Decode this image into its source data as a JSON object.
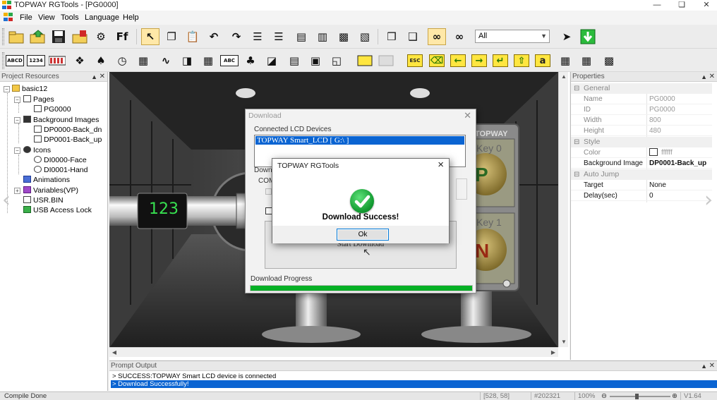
{
  "window": {
    "title": "TOPWAY RGTools - [PG0000]"
  },
  "menu": {
    "items": [
      "File",
      "View",
      "Tools",
      "Language",
      "Help"
    ]
  },
  "toolbar": {
    "filter_value": "All",
    "row1_icons": [
      "new-project-icon",
      "open-project-icon",
      "save-icon",
      "export-icon",
      "settings-icon",
      "font-icon",
      "select-pointer-icon",
      "copy-icon",
      "paste-icon",
      "undo-icon",
      "redo-icon",
      "align-left-icon",
      "align-right-icon",
      "align-top-icon",
      "align-bottom-icon",
      "distribute-horizontal-icon",
      "distribute-vertical-icon",
      "bring-front-icon",
      "send-back-icon",
      "preview-glasses-icon",
      "preview-off-icon",
      "build-icon",
      "download-icon"
    ],
    "row2_labels": {
      "abcd": "ABCD",
      "n1234": "1234",
      "abc": "ABC"
    }
  },
  "project_panel": {
    "title": "Project Resources",
    "tree": [
      {
        "label": "basic12",
        "level": 0
      },
      {
        "label": "Pages",
        "level": 1
      },
      {
        "label": "PG0000",
        "level": 2
      },
      {
        "label": "Background Images",
        "level": 1
      },
      {
        "label": "DP0000-Back_dn",
        "level": 2
      },
      {
        "label": "DP0001-Back_up",
        "level": 2
      },
      {
        "label": "Icons",
        "level": 1
      },
      {
        "label": "DI0000-Face",
        "level": 2
      },
      {
        "label": "DI0001-Hand",
        "level": 2
      },
      {
        "label": "Animations",
        "level": 1
      },
      {
        "label": "Variables(VP)",
        "level": 1
      },
      {
        "label": "USR.BIN",
        "level": 1
      },
      {
        "label": "USB Access Lock",
        "level": 1
      }
    ]
  },
  "canvas": {
    "display_value": "123",
    "brand_text": "TOPWAY",
    "key0_label": "Key 0",
    "key1_label": "Key 1",
    "key0_letter": "P",
    "key1_letter": "N"
  },
  "properties": {
    "title": "Properties",
    "groups": [
      {
        "name": "General",
        "rows": [
          {
            "k": "Name",
            "v": "PG0000"
          },
          {
            "k": "ID",
            "v": "PG0000"
          },
          {
            "k": "Width",
            "v": "800"
          },
          {
            "k": "Height",
            "v": "480"
          }
        ]
      },
      {
        "name": "Style",
        "rows": [
          {
            "k": "Color",
            "v": "ffffff"
          },
          {
            "k": "Background Image",
            "v": "DP0001-Back_up"
          }
        ]
      },
      {
        "name": "Auto Jump",
        "rows": [
          {
            "k": "Target",
            "v": "None"
          },
          {
            "k": "Delay(sec)",
            "v": "0"
          }
        ]
      }
    ]
  },
  "download_dialog": {
    "title": "Download",
    "devices_label": "Connected LCD Devices",
    "device_item": "TOPWAY Smart_LCD [ G:\\ ]",
    "partial_label": "Downl",
    "com_label": "COM",
    "start_button": "Start Download",
    "progress_label": "Download Progress",
    "progress": 1.0
  },
  "message_box": {
    "title": "TOPWAY RGTools",
    "message": "Download Success!",
    "ok_label": "Ok"
  },
  "prompt": {
    "title": "Prompt Output",
    "lines": [
      "> SUCCESS:TOPWAY Smart LCD device is connected",
      "> Download Successfully!"
    ]
  },
  "status": {
    "left": "Compile Done",
    "coords": "[528, 58]",
    "color": "#202321",
    "zoom": "100%",
    "version": "V1.64"
  }
}
